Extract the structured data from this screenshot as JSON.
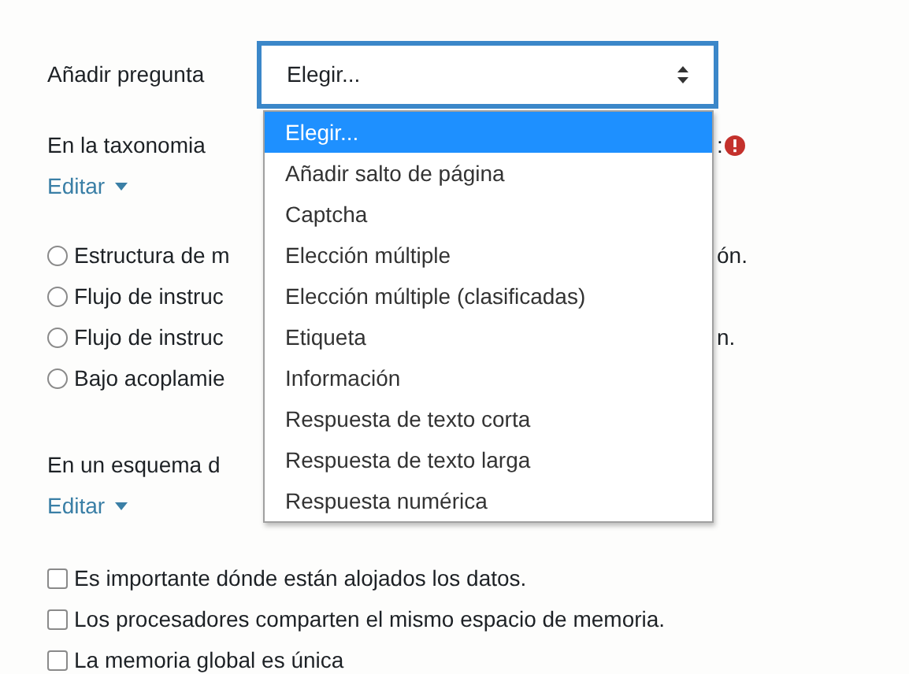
{
  "add_question": {
    "label": "Añadir pregunta",
    "select": {
      "value": "Elegir...",
      "open": true,
      "options": [
        {
          "label": "Elegir...",
          "selected": true
        },
        {
          "label": "Añadir salto de página",
          "selected": false
        },
        {
          "label": "Captcha",
          "selected": false
        },
        {
          "label": "Elección múltiple",
          "selected": false
        },
        {
          "label": "Elección múltiple (clasificadas)",
          "selected": false
        },
        {
          "label": "Etiqueta",
          "selected": false
        },
        {
          "label": "Información",
          "selected": false
        },
        {
          "label": "Respuesta de texto corta",
          "selected": false
        },
        {
          "label": "Respuesta de texto larga",
          "selected": false
        },
        {
          "label": "Respuesta numérica",
          "selected": false
        }
      ]
    }
  },
  "questions": [
    {
      "text_left": "En la taxonomia",
      "text_right": ":",
      "required": true,
      "edit": "Editar",
      "kind": "radio",
      "answers": [
        {
          "left": "Estructura de m",
          "right": "ón.",
          "checked": false
        },
        {
          "left": "Flujo de instruc",
          "checked": false
        },
        {
          "left": "Flujo de instruc",
          "right": "n.",
          "checked": false
        },
        {
          "left": "Bajo acoplamie",
          "checked": false
        }
      ]
    },
    {
      "text_left": "En un esquema d",
      "required": false,
      "edit": "Editar",
      "kind": "checkbox",
      "answers": [
        {
          "left": "Es importante dónde están alojados los datos.",
          "checked": false
        },
        {
          "left": "Los procesadores comparten el mismo espacio de memoria.",
          "checked": false
        },
        {
          "left": "La memoria global es única",
          "checked": false
        }
      ]
    }
  ]
}
